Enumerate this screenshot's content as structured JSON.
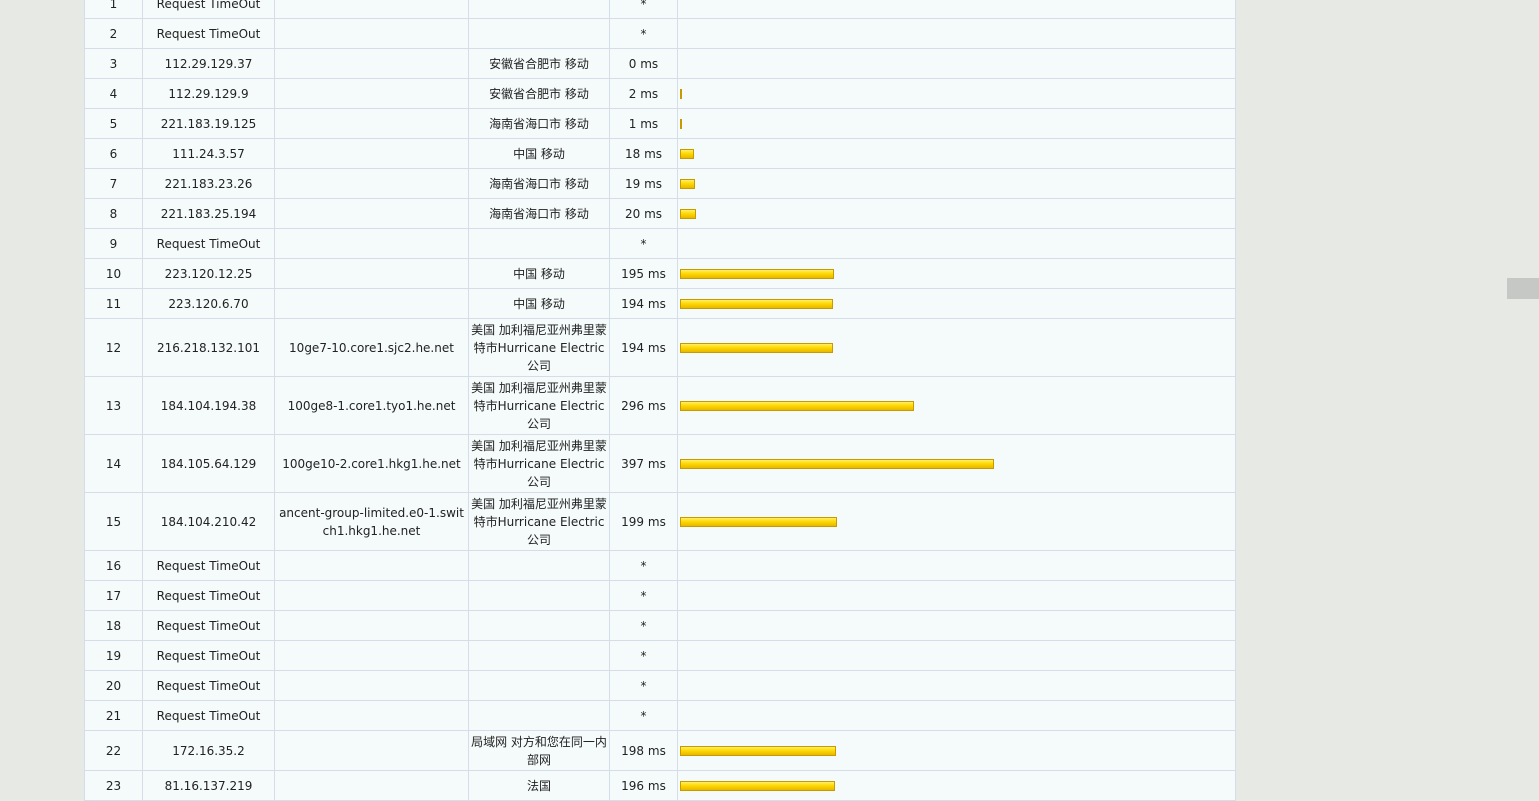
{
  "max_ms": 2000,
  "hops": [
    {
      "hop": "1",
      "ip": "Request TimeOut",
      "host": "",
      "location": "",
      "latency": "*",
      "ms": null
    },
    {
      "hop": "2",
      "ip": "Request TimeOut",
      "host": "",
      "location": "",
      "latency": "*",
      "ms": null
    },
    {
      "hop": "3",
      "ip": "112.29.129.37",
      "host": "",
      "location": "安徽省合肥市 移动",
      "latency": "0 ms",
      "ms": 0
    },
    {
      "hop": "4",
      "ip": "112.29.129.9",
      "host": "",
      "location": "安徽省合肥市 移动",
      "latency": "2 ms",
      "ms": 2
    },
    {
      "hop": "5",
      "ip": "221.183.19.125",
      "host": "",
      "location": "海南省海口市 移动",
      "latency": "1 ms",
      "ms": 1
    },
    {
      "hop": "6",
      "ip": "111.24.3.57",
      "host": "",
      "location": "中国 移动",
      "latency": "18 ms",
      "ms": 18
    },
    {
      "hop": "7",
      "ip": "221.183.23.26",
      "host": "",
      "location": "海南省海口市 移动",
      "latency": "19 ms",
      "ms": 19
    },
    {
      "hop": "8",
      "ip": "221.183.25.194",
      "host": "",
      "location": "海南省海口市 移动",
      "latency": "20 ms",
      "ms": 20
    },
    {
      "hop": "9",
      "ip": "Request TimeOut",
      "host": "",
      "location": "",
      "latency": "*",
      "ms": null
    },
    {
      "hop": "10",
      "ip": "223.120.12.25",
      "host": "",
      "location": "中国 移动",
      "latency": "195 ms",
      "ms": 195
    },
    {
      "hop": "11",
      "ip": "223.120.6.70",
      "host": "",
      "location": "中国 移动",
      "latency": "194 ms",
      "ms": 194
    },
    {
      "hop": "12",
      "ip": "216.218.132.101",
      "host": "10ge7-10.core1.sjc2.he.net",
      "location": "美国 加利福尼亚州弗里蒙特市Hurricane Electric公司",
      "latency": "194 ms",
      "ms": 194
    },
    {
      "hop": "13",
      "ip": "184.104.194.38",
      "host": "100ge8-1.core1.tyo1.he.net",
      "location": "美国 加利福尼亚州弗里蒙特市Hurricane Electric公司",
      "latency": "296 ms",
      "ms": 296
    },
    {
      "hop": "14",
      "ip": "184.105.64.129",
      "host": "100ge10-2.core1.hkg1.he.net",
      "location": "美国 加利福尼亚州弗里蒙特市Hurricane Electric公司",
      "latency": "397 ms",
      "ms": 397
    },
    {
      "hop": "15",
      "ip": "184.104.210.42",
      "host": "ancent-group-limited.e0-1.switch1.hkg1.he.net",
      "location": "美国 加利福尼亚州弗里蒙特市Hurricane Electric公司",
      "latency": "199 ms",
      "ms": 199
    },
    {
      "hop": "16",
      "ip": "Request TimeOut",
      "host": "",
      "location": "",
      "latency": "*",
      "ms": null
    },
    {
      "hop": "17",
      "ip": "Request TimeOut",
      "host": "",
      "location": "",
      "latency": "*",
      "ms": null
    },
    {
      "hop": "18",
      "ip": "Request TimeOut",
      "host": "",
      "location": "",
      "latency": "*",
      "ms": null
    },
    {
      "hop": "19",
      "ip": "Request TimeOut",
      "host": "",
      "location": "",
      "latency": "*",
      "ms": null
    },
    {
      "hop": "20",
      "ip": "Request TimeOut",
      "host": "",
      "location": "",
      "latency": "*",
      "ms": null
    },
    {
      "hop": "21",
      "ip": "Request TimeOut",
      "host": "",
      "location": "",
      "latency": "*",
      "ms": null
    },
    {
      "hop": "22",
      "ip": "172.16.35.2",
      "host": "",
      "location": "局域网 对方和您在同一内部网",
      "latency": "198 ms",
      "ms": 198
    },
    {
      "hop": "23",
      "ip": "81.16.137.219",
      "host": "",
      "location": "法国",
      "latency": "196 ms",
      "ms": 196
    }
  ]
}
